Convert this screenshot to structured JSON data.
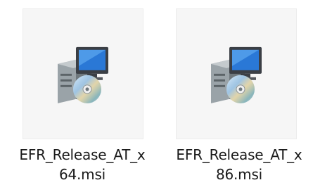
{
  "files": [
    {
      "name_line1": "EFR_Release_AT_x",
      "name_line2": "64.msi",
      "icon": "windows-installer-package-icon"
    },
    {
      "name_line1": "EFR_Release_AT_x",
      "name_line2": "86.msi",
      "icon": "windows-installer-package-icon"
    }
  ],
  "colors": {
    "thumb_background": "#f6f6f6",
    "monitor_screen": "#2a78d6",
    "box_body": "#8a9399",
    "label_text": "#1a1a1a"
  }
}
